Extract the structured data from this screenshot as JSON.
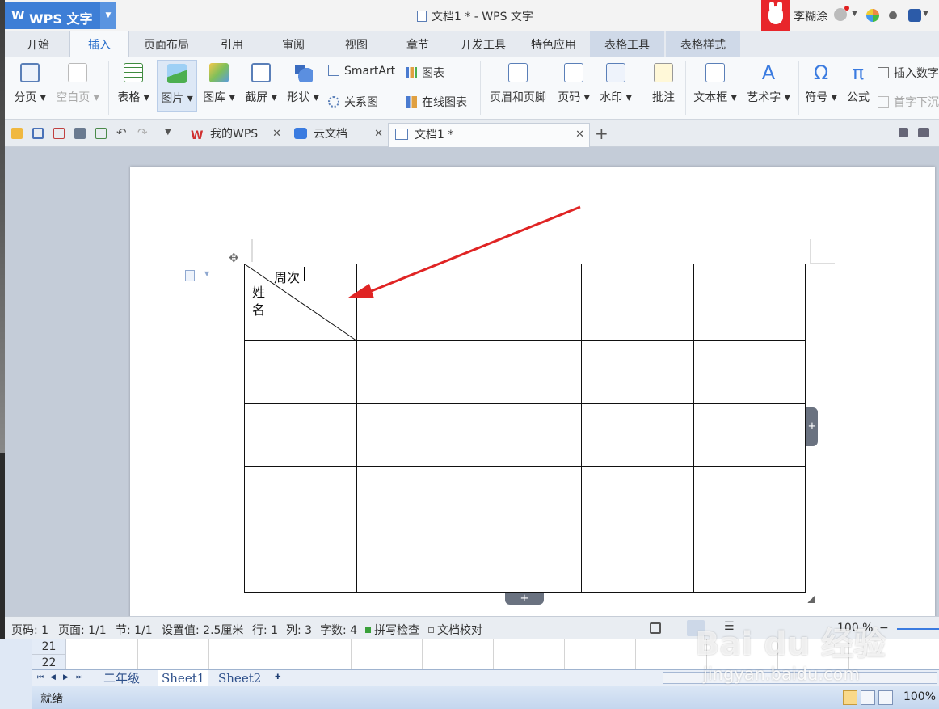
{
  "title_bar": {
    "app_name": "WPS 文字",
    "window_title": "文档1 * - WPS 文字",
    "user_name": "李糊涂"
  },
  "menu_tabs": [
    {
      "label": "开始"
    },
    {
      "label": "插入"
    },
    {
      "label": "页面布局"
    },
    {
      "label": "引用"
    },
    {
      "label": "审阅"
    },
    {
      "label": "视图"
    },
    {
      "label": "章节"
    },
    {
      "label": "开发工具"
    },
    {
      "label": "特色应用"
    },
    {
      "label": "表格工具"
    },
    {
      "label": "表格样式"
    }
  ],
  "active_tab": "插入",
  "ribbon": {
    "page_break": "分页",
    "blank_page": "空白页",
    "table": "表格",
    "picture": "图片",
    "gallery": "图库",
    "screenshot": "截屏",
    "shapes": "形状",
    "smartart": "SmartArt",
    "chart": "图表",
    "relation": "关系图",
    "online_chart": "在线图表",
    "header_footer": "页眉和页脚",
    "page_number": "页码",
    "watermark": "水印",
    "comment": "批注",
    "textbox": "文本框",
    "wordart": "艺术字",
    "symbol": "符号",
    "formula": "公式",
    "insert_number": "插入数字",
    "drop_cap": "首字下沉",
    "symbol_glyph": "Ω",
    "formula_glyph": "π",
    "wordart_glyph": "A"
  },
  "doc_tabs": [
    {
      "label": "我的WPS"
    },
    {
      "label": "云文档"
    },
    {
      "label": "文档1 *"
    }
  ],
  "document": {
    "header_cell": {
      "top_right": "周次",
      "bottom_left_1": "姓",
      "bottom_left_2": "名"
    },
    "table": {
      "rows": 5,
      "cols": 5
    }
  },
  "status_bar": {
    "page_num": "页码: 1",
    "pages": "页面: 1/1",
    "section": "节: 1/1",
    "setting": "设置值: 2.5厘米",
    "row": "行: 1",
    "col": "列: 3",
    "word_count": "字数: 4",
    "spell_check": "拼写检查",
    "doc_proof": "文档校对",
    "zoom": "100 %"
  },
  "excel_background": {
    "row_numbers": [
      "21",
      "22"
    ],
    "sheet_tabs": [
      "二年级",
      "Sheet1",
      "Sheet2"
    ],
    "status_text": "就绪",
    "zoom": "100%"
  },
  "watermark": {
    "brand": "Bai du 经验",
    "url": "jingyan.baidu.com"
  },
  "colors": {
    "accent": "#3d7ed6",
    "arrow": "#e02424",
    "active_tab_text": "#2a6fcb"
  }
}
